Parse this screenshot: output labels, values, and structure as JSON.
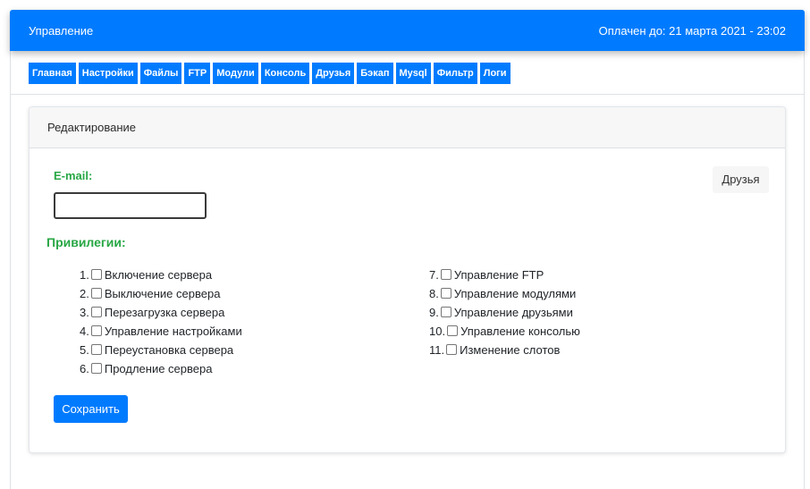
{
  "header": {
    "title": "Управление",
    "paid_until": "Оплачен до: 21 марта 2021 - 23:02"
  },
  "nav": {
    "items": [
      "Главная",
      "Настройки",
      "Файлы",
      "FTP",
      "Модули",
      "Консоль",
      "Друзья",
      "Бэкап",
      "Mysql",
      "Фильтр",
      "Логи"
    ]
  },
  "card": {
    "header": "Редактирование",
    "email_label": "E-mail:",
    "email_value": "",
    "friends_button": "Друзья",
    "privileges_title": "Привилегии:",
    "privileges_left": [
      {
        "num": "1.",
        "label": "Включение сервера",
        "checked": false
      },
      {
        "num": "2.",
        "label": "Выключение сервера",
        "checked": false
      },
      {
        "num": "3.",
        "label": "Перезагрузка сервера",
        "checked": false
      },
      {
        "num": "4.",
        "label": "Управление настройками",
        "checked": false
      },
      {
        "num": "5.",
        "label": "Переустановка сервера",
        "checked": false
      },
      {
        "num": "6.",
        "label": "Продление сервера",
        "checked": false
      }
    ],
    "privileges_right": [
      {
        "num": "7.",
        "label": "Управление FTP",
        "checked": false
      },
      {
        "num": "8.",
        "label": "Управление модулями",
        "checked": false
      },
      {
        "num": "9.",
        "label": "Управление друзьями",
        "checked": false
      },
      {
        "num": "10.",
        "label": "Управление консолью",
        "checked": false
      },
      {
        "num": "11.",
        "label": "Изменение слотов",
        "checked": false
      }
    ],
    "save_button": "Сохранить"
  },
  "colors": {
    "primary": "#007bff",
    "success": "#28a745"
  }
}
